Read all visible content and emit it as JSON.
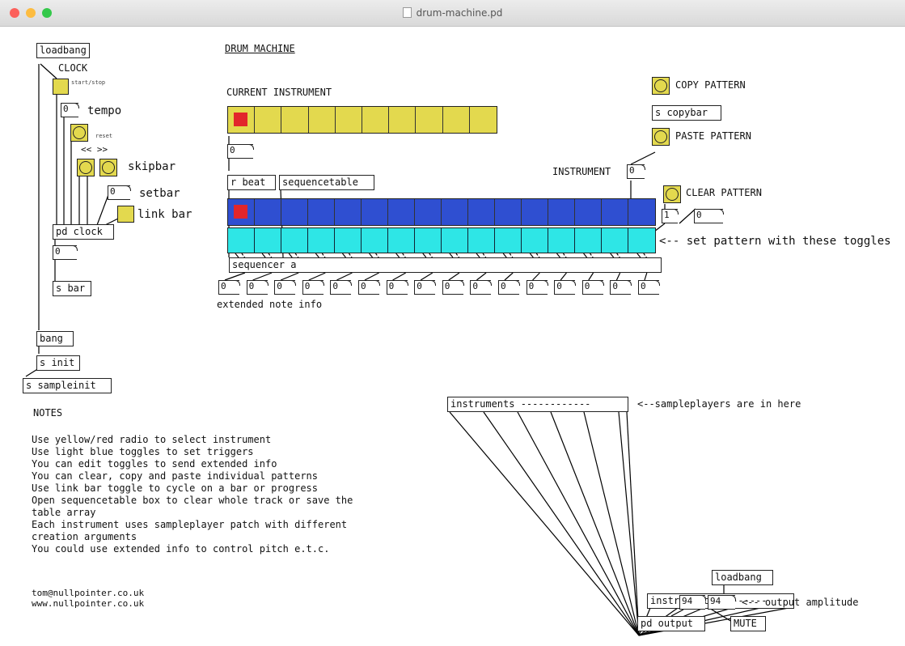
{
  "window": {
    "title": "drum-machine.pd",
    "buttons": {
      "close": "#fc605b",
      "minimize": "#fdbc40",
      "zoom": "#34c84a"
    }
  },
  "colors": {
    "yellow": "#e3d94e",
    "red": "#e2262b",
    "blue": "#2f4fd1",
    "cyan": "#2ee6e6"
  },
  "clock_section": {
    "loadbang": "loadbang",
    "clock_label": "CLOCK",
    "start_stop_label": "start/stop",
    "tempo_number": "0",
    "tempo_label": "tempo",
    "reset_label": "reset",
    "skip_arrows": "<< >>",
    "skipbar_label": "skipbar",
    "setbar_number": "0",
    "setbar_label": "setbar",
    "linkbar_label": "link bar",
    "pd_clock": "pd clock",
    "bar_number": "0",
    "s_bar": "s bar",
    "bang": "bang",
    "s_init": "s init",
    "s_sampleinit": "s sampleinit"
  },
  "main": {
    "title": "DRUM MACHINE",
    "current_instrument_label": "CURRENT INSTRUMENT",
    "instrument_radio": {
      "cells": 10,
      "selected": 0
    },
    "instrument_number": "0",
    "r_beat": "r beat",
    "sequencetable": "sequencetable",
    "instrument_label": "INSTRUMENT",
    "instrument_value": "0",
    "beat_radio": {
      "cells": 16,
      "selected": 0
    },
    "toggle_row": {
      "cells": 16
    },
    "set_pattern_label": "<-- set pattern with these toggles",
    "sequencer": "sequencer a",
    "note_numbers": [
      "0",
      "0",
      "0",
      "0",
      "0",
      "0",
      "0",
      "0",
      "0",
      "0",
      "0",
      "0",
      "0",
      "0",
      "0",
      "0"
    ],
    "extended_note_info": "extended note info"
  },
  "pattern_controls": {
    "copy_label": "COPY PATTERN",
    "s_copybar": "s copybar",
    "paste_label": "PASTE PATTERN",
    "clear_label": "CLEAR PATTERN",
    "clear_number": "1",
    "clear_value": "0"
  },
  "audio": {
    "instruments": "instruments ------------",
    "sampleplayers_label": "<--sampleplayers are in here",
    "instruments2": "instruments2 -------",
    "loadbang": "loadbang",
    "amp_left": "94",
    "amp_right": "94",
    "output_amplitude_label": "<-- output amplitude",
    "pd_output": "pd output",
    "mute": "MUTE"
  },
  "notes": {
    "heading": "NOTES",
    "lines": [
      "Use yellow/red radio to select instrument",
      "Use light blue toggles to set triggers",
      "You can edit toggles to send extended info",
      "You can clear, copy and paste individual patterns",
      "Use link bar toggle to cycle on a bar or progress",
      "Open sequencetable box to clear whole track or save the",
      "table array",
      "Each instrument uses sampleplayer patch with different",
      "creation arguments",
      "You could use extended info to control pitch e.t.c."
    ],
    "contact": [
      "tom@nullpointer.co.uk",
      "www.nullpointer.co.uk"
    ]
  }
}
